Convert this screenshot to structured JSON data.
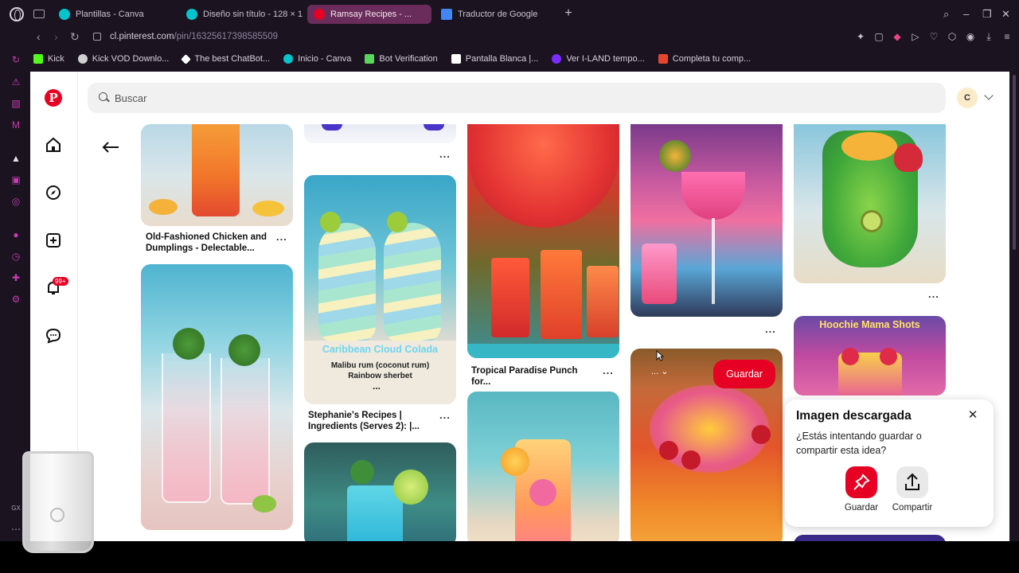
{
  "browser": {
    "tabs": [
      {
        "title": "Plantillas - Canva",
        "color": "#00c4cc"
      },
      {
        "title": "Diseño sin título - 128 × 1...",
        "color": "#00c4cc"
      },
      {
        "title": "Ramsay Recipes - ...",
        "color": "#e60023",
        "active": true
      },
      {
        "title": "Traductor de Google",
        "color": "#4285f4"
      }
    ],
    "url_domain": "cl.pinterest.com",
    "url_path": "/pin/16325617398585509",
    "bookmarks": [
      {
        "label": "Kick",
        "color": "#53fc18"
      },
      {
        "label": "Kick VOD Downlo...",
        "color": "#cfcfcf"
      },
      {
        "label": "The best ChatBot...",
        "color": "#ffffff"
      },
      {
        "label": "Inicio - Canva",
        "color": "#00c4cc"
      },
      {
        "label": "Bot Verification",
        "color": "#5fd35f"
      },
      {
        "label": "Pantalla Blanca |...",
        "color": "#ffffff"
      },
      {
        "label": "Ver I-LAND tempo...",
        "color": "#7b2cff"
      },
      {
        "label": "Completa tu comp...",
        "color": "#e8452f"
      }
    ]
  },
  "pinterest": {
    "search_placeholder": "Buscar",
    "avatar_initial": "C",
    "notifications_badge": "99+",
    "pins": {
      "p1_caption": "Old-Fashioned Chicken and Dumplings - Delectable...",
      "p4_caption": "Stephanie's Recipes | Ingredients (Serves 2): |...",
      "p4_overlay_title": "Caribbean Cloud Colada",
      "p4_overlay_line1": "Malibu rum (coconut rum)",
      "p4_overlay_line2": "Rainbow sherbet",
      "p6_caption": "Tropical Paradise Punch for...",
      "p10_overlay_title": "Hoochie Mama Shots",
      "more": "...",
      "save_label": "Guardar"
    },
    "toast": {
      "title": "Imagen descargada",
      "message": "¿Estás intentando guardar o compartir esta idea?",
      "save_label": "Guardar",
      "share_label": "Compartir"
    }
  },
  "colors": {
    "brand": "#e60023"
  }
}
